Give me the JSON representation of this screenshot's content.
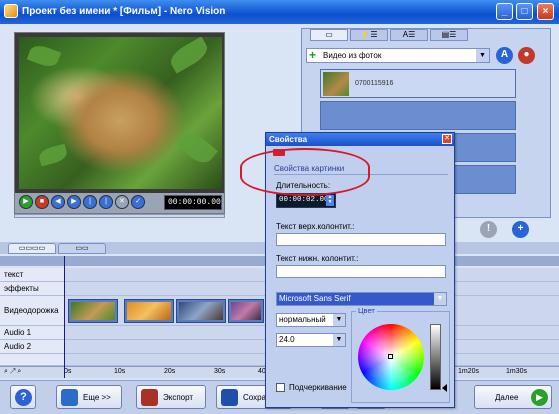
{
  "window": {
    "title": "Проект без имени * [Фильм] - Nero Vision",
    "minimize": "_",
    "maximize": "□",
    "close": "×"
  },
  "player": {
    "time": "00:00:00.00",
    "progress": 0
  },
  "media_panel": {
    "tabs": [
      "▭",
      "⚡☰",
      "A☰",
      "▤☰"
    ],
    "category": "Видео из фоток",
    "items": [
      {
        "name": "0700115916"
      },
      {
        "name": ""
      },
      {
        "name": ""
      },
      {
        "name": ""
      }
    ]
  },
  "timeline": {
    "tracks": [
      "текст",
      "эффекты",
      "Видеодорожка",
      "Audio 1",
      "Audio 2"
    ],
    "ruler_ticks": [
      "0s",
      "10s",
      "20s",
      "30s",
      "40s",
      "1m20s",
      "1m30s"
    ]
  },
  "dialog": {
    "title": "Свойства",
    "section": "Свойства картинки",
    "duration_label": "Длительность:",
    "duration_value": "00:00:02.00",
    "header_label": "Текст верх.колонтит.:",
    "footer_label": "Текст нижн. колонтит.:",
    "font": "Microsoft Sans Serif",
    "style": "нормальный",
    "size": "24.0",
    "color_label": "Цвет",
    "underline_label": "Подчеркивание"
  },
  "bottom": {
    "help": "?",
    "more": "Еще >>",
    "export": "Экспорт",
    "save": "Сохранить",
    "next": "Далее"
  },
  "colors": {
    "accent": "#1b52c7",
    "highlight": "#d7182a"
  }
}
